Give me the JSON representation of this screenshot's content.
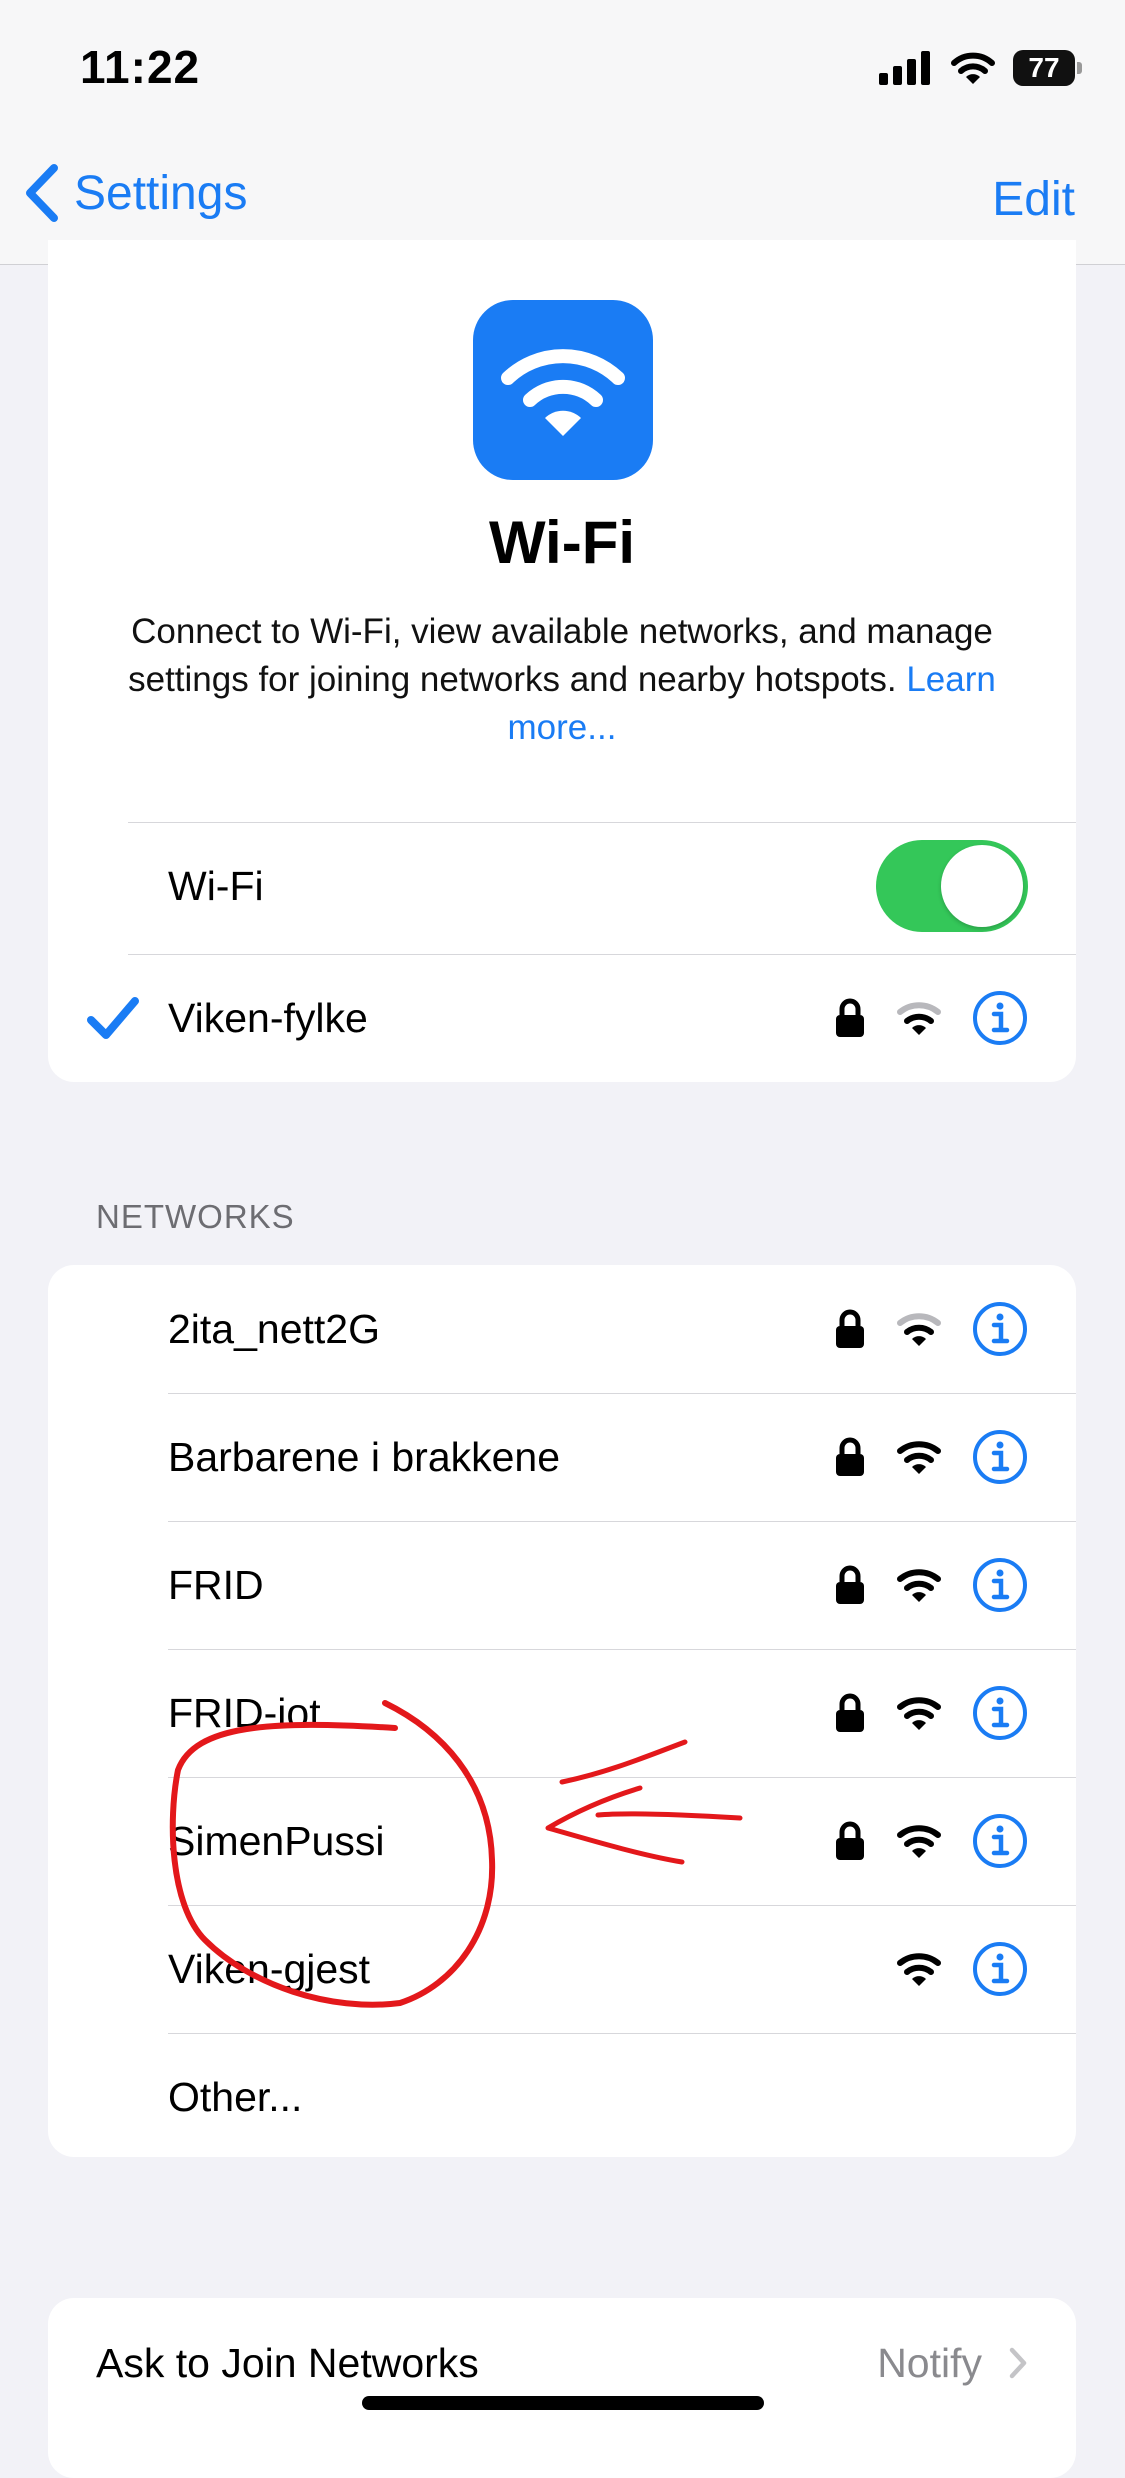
{
  "status_bar": {
    "time": "11:22",
    "battery": "77"
  },
  "nav": {
    "back_label": "Settings",
    "edit_label": "Edit"
  },
  "header": {
    "title": "Wi-Fi",
    "description": "Connect to Wi-Fi, view available networks, and manage settings for joining networks and nearby hotspots.",
    "learn_more": "Learn more..."
  },
  "wifi_toggle": {
    "label": "Wi-Fi",
    "on": true
  },
  "connected": {
    "name": "Viken-fylke",
    "locked": true,
    "signal": "wifi-weak-icon"
  },
  "networks_header": "NETWORKS",
  "networks": [
    {
      "name": "2ita_nett2G",
      "locked": true,
      "signal": "wifi-weak-icon"
    },
    {
      "name": "Barbarene i brakkene",
      "locked": true,
      "signal": "wifi-full-icon"
    },
    {
      "name": "FRID",
      "locked": true,
      "signal": "wifi-full-icon"
    },
    {
      "name": "FRID-iot",
      "locked": true,
      "signal": "wifi-full-icon"
    },
    {
      "name": "SimenPussi",
      "locked": true,
      "signal": "wifi-full-icon"
    },
    {
      "name": "Viken-gjest",
      "locked": false,
      "signal": "wifi-full-icon"
    }
  ],
  "other_label": "Other...",
  "ask_to_join": {
    "label": "Ask to Join Networks",
    "value": "Notify"
  },
  "colors": {
    "accent": "#1a7cf4",
    "toggle_on": "#34c759",
    "annotation": "#e3181b"
  }
}
